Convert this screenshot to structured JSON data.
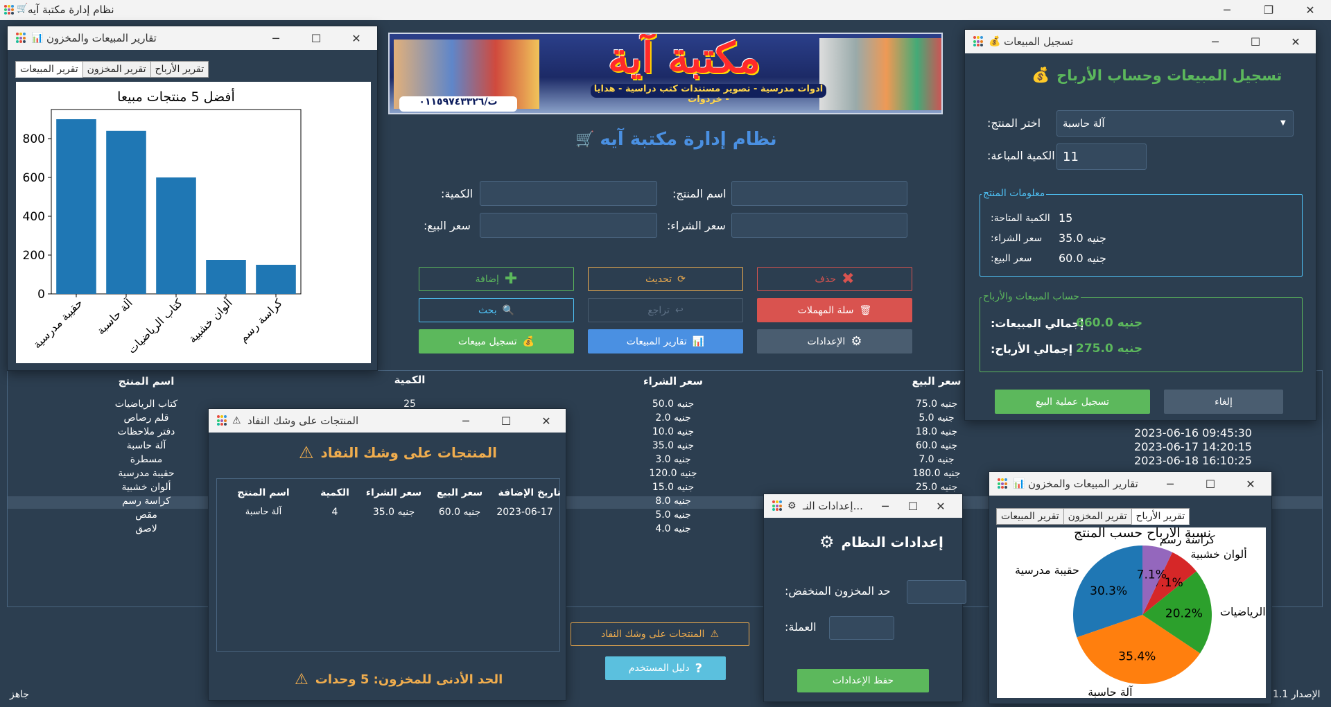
{
  "main": {
    "title": "نظام إدارة مكتبة آيه",
    "status": "جاهز",
    "version": "الإصدار 1.1"
  },
  "banner": {
    "shop_name": "مكتبة آية",
    "tagline": "ادوات مدرسية - تصوير مستندات كتب دراسية - هدايا - خردوات",
    "phone": "ت/٠١١٥٩٧٤٣٣٢٦"
  },
  "header": {
    "title": "نظام إدارة مكتبة آيه"
  },
  "form": {
    "product_name_label": ":اسم المنتج",
    "quantity_label": ":الكمية",
    "buy_price_label": ":سعر الشراء",
    "sell_price_label": ":سعر البيع"
  },
  "buttons": {
    "delete": "حذف",
    "update": "تحديث",
    "add": "إضافة",
    "recycle": "سلة المهملات",
    "undo": "تراجع",
    "search": "بحث",
    "settings": "الإعدادات",
    "sales_reports": "تقارير المبيعات",
    "record_sale": "تسجيل مبيعات",
    "low_stock": "المنتجات على وشك النفاد",
    "user_guide": "دليل المستخدم"
  },
  "table": {
    "headers": {
      "name": "اسم المنتج",
      "qty": "الكمية",
      "buy": "سعر الشراء",
      "sell": "سعر البيع"
    },
    "rows": [
      {
        "name": "كتاب الرياضيات",
        "qty": "25",
        "buy": "50.0 جنيه",
        "sell": "75.0 جنيه",
        "date": ""
      },
      {
        "name": "قلم رصاص",
        "qty": "",
        "buy": "2.0 جنيه",
        "sell": "5.0 جنيه",
        "date": ""
      },
      {
        "name": "دفتر ملاحظات",
        "qty": "",
        "buy": "10.0 جنيه",
        "sell": "18.0 جنيه",
        "date": "2023-06-16 09:45:30"
      },
      {
        "name": "آلة حاسبة",
        "qty": "",
        "buy": "35.0 جنيه",
        "sell": "60.0 جنيه",
        "date": "2023-06-17 14:20:15"
      },
      {
        "name": "مسطرة",
        "qty": "",
        "buy": "3.0 جنيه",
        "sell": "7.0 جنيه",
        "date": "2023-06-18 16:10:25"
      },
      {
        "name": "حقيبة مدرسية",
        "qty": "",
        "buy": "120.0 جنيه",
        "sell": "180.0 جنيه",
        "date": ""
      },
      {
        "name": "ألوان خشبية",
        "qty": "",
        "buy": "15.0 جنيه",
        "sell": "25.0 جنيه",
        "date": ""
      },
      {
        "name": "كراسة رسم",
        "qty": "",
        "buy": "8.0 جنيه",
        "sell": "",
        "date": ""
      },
      {
        "name": "مقص",
        "qty": "",
        "buy": "5.0 جنيه",
        "sell": "",
        "date": ""
      },
      {
        "name": "لاصق",
        "qty": "",
        "buy": "4.0 جنيه",
        "sell": "",
        "date": ""
      }
    ]
  },
  "reports_window_1": {
    "title": "تقارير المبيعات والمخزون",
    "tabs": [
      "تقرير الأرباح",
      "تقرير المخزون",
      "تقرير المبيعات"
    ]
  },
  "reports_window_2": {
    "title": "تقارير المبيعات والمخزون",
    "tabs": [
      "تقرير الأرباح",
      "تقرير المخزون",
      "تقرير المبيعات"
    ]
  },
  "sales_window": {
    "title": "تسجيل المبيعات",
    "heading": "تسجيل المبيعات وحساب الأرباح",
    "choose_product_label": ":اختر المنتج",
    "selected_product": "آلة حاسبة",
    "sold_qty_label": ":الكمية المباعة",
    "sold_qty_value": "11",
    "info_group": "معلومات المنتج",
    "available_label": ":الكمية المتاحة",
    "available_value": "15",
    "buy_label": ":سعر الشراء",
    "buy_value": "35.0 جنيه",
    "sell_label": ":سعر البيع",
    "sell_value": "60.0 جنيه",
    "calc_group": "حساب المبيعات والأرباح",
    "total_sales_label": ":إجمالي المبيعات",
    "total_sales_value": "660.0 جنيه",
    "total_profit_label": ":إجمالي الأرباح",
    "total_profit_value": "275.0 جنيه",
    "confirm": "تسجيل عملية البيع",
    "cancel": "إلغاء"
  },
  "lowstock_window": {
    "title": "المنتجات على وشك النفاد",
    "heading": "المنتجات على وشك النفاد",
    "headers": {
      "name": "اسم المنتج",
      "qty": "الكمية",
      "buy": "سعر الشراء",
      "sell": "سعر البيع",
      "date": "تاريخ الإضافة"
    },
    "rows": [
      {
        "name": "آلة حاسبة",
        "qty": "4",
        "buy": "35.0 جنيه",
        "sell": "60.0 جنيه",
        "date": "2023-06-17"
      }
    ],
    "footer": "الحد الأدنى للمخزون: 5 وحدات"
  },
  "settings_window": {
    "title": "إعدادات النـ...",
    "heading": "إعدادات النظام",
    "low_stock_label": ":حد المخزون المنخفض",
    "currency_label": ":العملة",
    "save": "حفظ الإعدادات"
  },
  "colors": {
    "bg": "#2c3e50",
    "green": "#5cb85c",
    "blue": "#4a90e2",
    "red": "#d9534f",
    "orange": "#f0ad4e",
    "heading_blue": "#4a90e2",
    "chart_blue": "#1f77b4"
  },
  "chart_data": [
    {
      "type": "bar",
      "title": "أفضل 5 منتجات مبيعا",
      "categories": [
        "حقيبة مدرسية",
        "آلة حاسبة",
        "كتاب الرياضيات",
        "ألوان خشبية",
        "كراسة رسم"
      ],
      "values": [
        900,
        840,
        600,
        175,
        150
      ],
      "ylim": [
        0,
        950
      ],
      "yticks": [
        0,
        200,
        400,
        600,
        800
      ],
      "xlabel": "",
      "ylabel": ""
    },
    {
      "type": "pie",
      "title": "نسبة الأرباح حسب المنتج",
      "labels": [
        "حقيبة مدرسية",
        "آلة حاسبة",
        "كتاب الرياضيات",
        "ألوان خشبية",
        "كراسة رسم"
      ],
      "values": [
        30.3,
        35.4,
        20.2,
        7.1,
        7.1
      ],
      "value_labels": [
        "30.3%",
        "35.4%",
        "20.2%",
        "7.1%",
        "7.1%"
      ],
      "colors": [
        "#1f77b4",
        "#ff7f0e",
        "#2ca02c",
        "#d62728",
        "#9467bd"
      ]
    }
  ]
}
